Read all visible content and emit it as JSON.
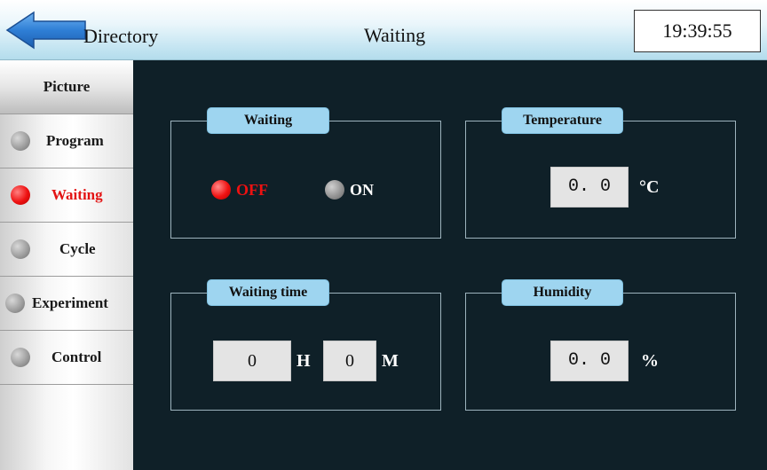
{
  "header": {
    "back_label": "Directory",
    "title": "Waiting",
    "clock": "19:39:55"
  },
  "sidebar": {
    "items": [
      {
        "label": "Picture",
        "icon": "none"
      },
      {
        "label": "Program",
        "icon": "radio-dot-icon",
        "active": false
      },
      {
        "label": "Waiting",
        "icon": "radio-dot-icon",
        "active": true
      },
      {
        "label": "Cycle",
        "icon": "radio-dot-icon",
        "active": false
      },
      {
        "label": "Experiment",
        "icon": "radio-dot-icon",
        "active": false
      },
      {
        "label": "Control",
        "icon": "radio-dot-icon",
        "active": false
      }
    ]
  },
  "panels": {
    "waiting": {
      "title": "Waiting",
      "off_label": "OFF",
      "on_label": "ON",
      "selected": "OFF"
    },
    "temperature": {
      "title": "Temperature",
      "value": "0. 0",
      "unit": "°C"
    },
    "waiting_time": {
      "title": "Waiting time",
      "hours": "0",
      "hours_unit": "H",
      "minutes": "0",
      "minutes_unit": "M"
    },
    "humidity": {
      "title": "Humidity",
      "value": "0. 0",
      "unit": "%"
    }
  },
  "colors": {
    "background": "#0f2028",
    "tag": "#9ed5f0",
    "active_red": "#ee1111"
  }
}
